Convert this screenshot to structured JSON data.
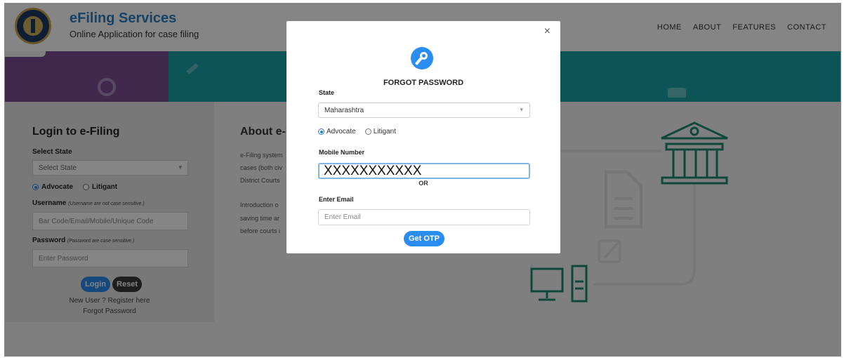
{
  "header": {
    "title": "eFiling Services",
    "subtitle": "Online Application for case filing",
    "nav": [
      "HOME",
      "ABOUT",
      "FEATURES",
      "CONTACT"
    ]
  },
  "login": {
    "title": "Login to e-Filing",
    "select_state_label": "Select State",
    "select_state_value": "Select State",
    "radio_advocate": "Advocate",
    "radio_litigant": "Litigant",
    "username_label": "Username",
    "username_note": "(Username are not case sensitive.)",
    "username_placeholder": "Bar Code/Email/Mobile/Unique Code",
    "password_label": "Password",
    "password_note": "(Password are case sensitive.)",
    "password_placeholder": "Enter Password",
    "login_button": "Login",
    "reset_button": "Reset",
    "register_link": "New User ? Register here",
    "forgot_link": "Forgot Password"
  },
  "about": {
    "title": "About e-F",
    "lines": [
      "e-Filing system",
      "cases (both civ",
      "District Courts",
      "",
      "Introduction o",
      "saving time ar",
      "before courts i"
    ]
  },
  "modal": {
    "close": "×",
    "title": "FORGOT PASSWORD",
    "state_label": "State",
    "state_value": "Maharashtra",
    "radio_advocate": "Advocate",
    "radio_litigant": "Litigant",
    "mobile_label": "Mobile Number",
    "mobile_value": "XXXXXXXXXXX",
    "or_text": "OR",
    "email_label": "Enter Email",
    "email_placeholder": "Enter Email",
    "otp_button": "Get OTP"
  },
  "colors": {
    "brand_blue": "#2b7fc4",
    "accent_blue": "#2a8df2",
    "banner_teal": "#1aa1a6",
    "banner_purple": "#7c4e95",
    "illustration_green": "#1e8a72",
    "reset_dark": "#3a3a3a"
  },
  "icons": [
    "logo-emblem",
    "key-icon",
    "close-icon",
    "court-building-icon",
    "document-icon",
    "edit-icon",
    "computer-icon"
  ]
}
